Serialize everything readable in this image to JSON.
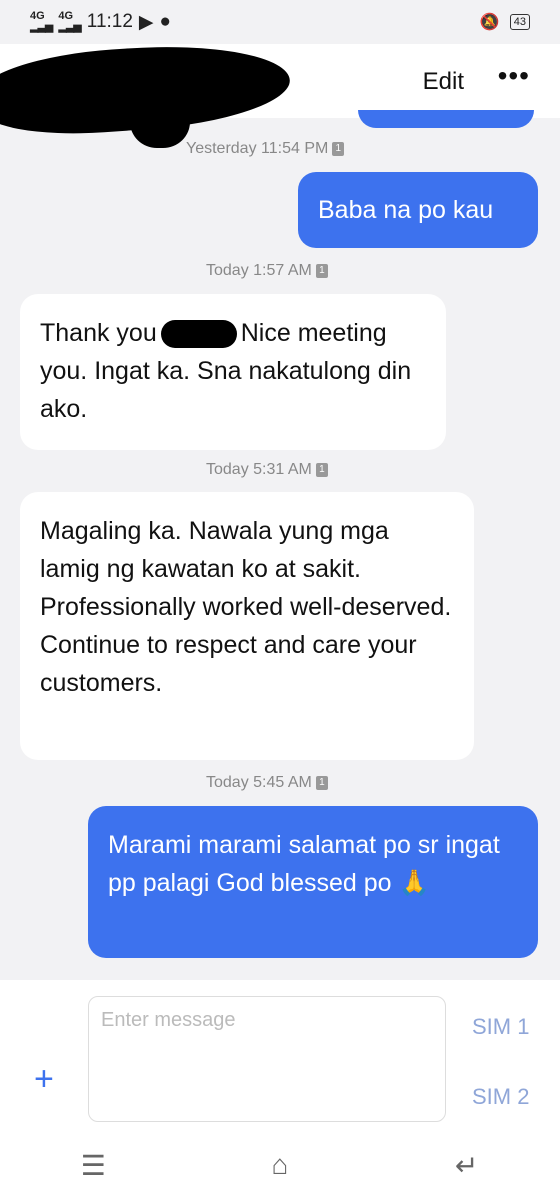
{
  "status_bar": {
    "signal1": "4G",
    "signal2": "4G",
    "time": "11:12",
    "battery": "43"
  },
  "header": {
    "edit_label": "Edit",
    "more_label": "•••"
  },
  "messages": [
    {
      "kind": "stamp",
      "text": "Yesterday 11:54 PM"
    },
    {
      "kind": "out",
      "text": "Baba na po kau"
    },
    {
      "kind": "stamp",
      "text": "Today 1:57 AM"
    },
    {
      "kind": "in",
      "text_before": "Thank you",
      "text_after": "Nice meeting you. Ingat ka. Sna nakatulong din ako."
    },
    {
      "kind": "stamp",
      "text": "Today 5:31 AM"
    },
    {
      "kind": "in",
      "text": "Magaling ka. Nawala yung mga lamig ng kawatan ko at sakit. Professionally worked well-deserved. Continue to respect and care your customers."
    },
    {
      "kind": "stamp",
      "text": "Today 5:45 AM"
    },
    {
      "kind": "out",
      "text": "Marami marami salamat po sr ingat pp palagi God blessed po 🙏"
    }
  ],
  "sim_badge": "1",
  "composer": {
    "placeholder": "Enter message",
    "plus_label": "+",
    "sim1": "SIM 1",
    "sim2": "SIM 2"
  },
  "nav": {
    "menu_icon": "☰",
    "home_icon": "⌂",
    "back_icon": "↵"
  },
  "colors": {
    "outgoing": "#3d72ee",
    "incoming": "#ffffff",
    "background": "#f2f2f4"
  }
}
